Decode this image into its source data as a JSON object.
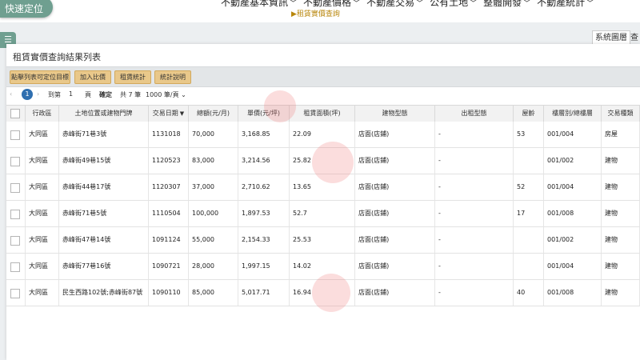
{
  "header": {
    "quick_locate": "快速定位",
    "nav": [
      "不動產基本資訊",
      "不動產價格",
      "不動產交易",
      "公有土地",
      "整體開發",
      "不動產統計"
    ],
    "breadcrumb": "▶租賃實價查詢"
  },
  "side_tabs": {
    "system_layer": "系統圖層",
    "more": "查"
  },
  "panel": {
    "title": "租賃實價查詢結果列表",
    "toolbar": [
      "點擊列表可定位目標",
      "加入比價",
      "租賃統計",
      "統計說明"
    ],
    "pager": {
      "current": "1",
      "goto_label": "到第",
      "page_input": "1",
      "page_unit": "頁",
      "confirm": "確定",
      "total": "共 7 筆",
      "per_page": "1000 筆/頁"
    }
  },
  "table": {
    "columns": [
      "行政區",
      "土地位置或建物門牌",
      "交易日期",
      "總額(元/月)",
      "單價(元/坪)",
      "租賃面積(坪)",
      "建物型態",
      "出租型態",
      "屋齡",
      "樓層別/總樓層",
      "交易種類"
    ],
    "rows": [
      [
        "大同區",
        "赤峰街71巷3號",
        "1131018",
        "70,000",
        "3,168.85",
        "22.09",
        "店面(店鋪)",
        "-",
        "53",
        "001/004",
        "房屋"
      ],
      [
        "大同區",
        "赤峰街49巷15號",
        "1120523",
        "83,000",
        "3,214.56",
        "25.82",
        "店面(店鋪)",
        "-",
        "",
        "001/002",
        "建物"
      ],
      [
        "大同區",
        "赤峰街44巷17號",
        "1120307",
        "37,000",
        "2,710.62",
        "13.65",
        "店面(店鋪)",
        "-",
        "52",
        "001/004",
        "建物"
      ],
      [
        "大同區",
        "赤峰街71巷5號",
        "1110504",
        "100,000",
        "1,897.53",
        "52.7",
        "店面(店鋪)",
        "-",
        "17",
        "001/008",
        "建物"
      ],
      [
        "大同區",
        "赤峰街47巷14號",
        "1091124",
        "55,000",
        "2,154.33",
        "25.53",
        "店面(店鋪)",
        "-",
        "",
        "001/002",
        "建物"
      ],
      [
        "大同區",
        "赤峰街77巷16號",
        "1090721",
        "28,000",
        "1,997.15",
        "14.02",
        "店面(店鋪)",
        "-",
        "",
        "001/004",
        "建物"
      ],
      [
        "大同區",
        "民生西路102號;赤峰街87號",
        "1090110",
        "85,000",
        "5,017.71",
        "16.94",
        "店面(店鋪)",
        "-",
        "40",
        "001/008",
        "建物"
      ]
    ]
  },
  "colors": {
    "accent": "#6f9f90",
    "button": "#e9c88a",
    "pager": "#2f6fb0"
  }
}
